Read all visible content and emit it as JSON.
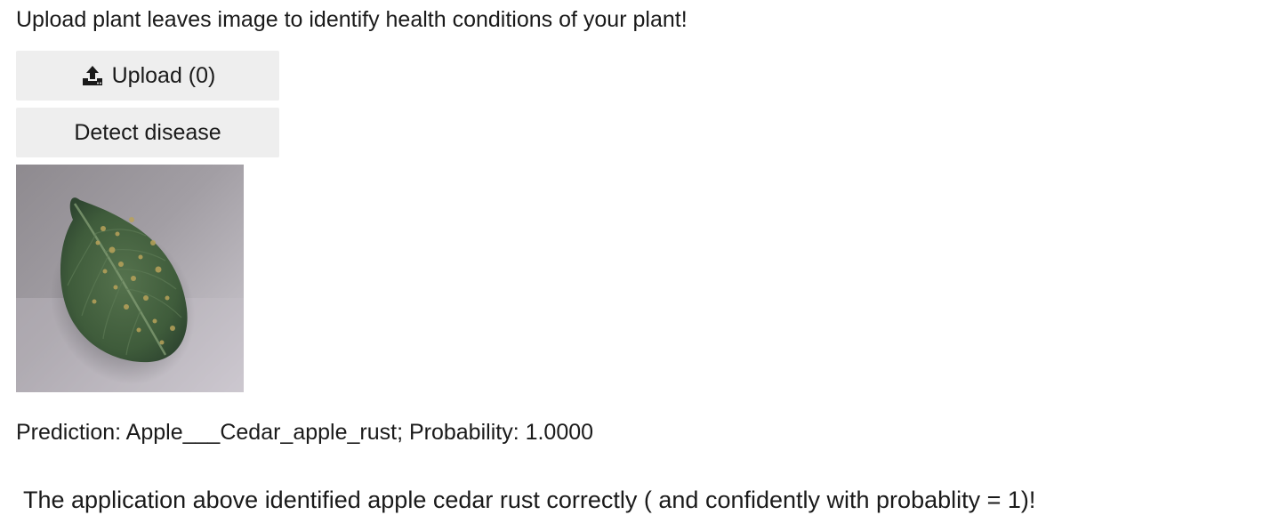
{
  "intro_text": "Upload plant leaves image to identify health conditions of your plant!",
  "upload_button": {
    "icon": "upload-icon",
    "label": "Upload (0)"
  },
  "detect_button": {
    "label": "Detect disease"
  },
  "prediction_text": "Prediction: Apple___Cedar_apple_rust; Probability: 1.0000",
  "note_text": "The application above identified apple cedar rust correctly ( and confidently with probablity = 1)!",
  "colors": {
    "button_bg": "#eeeeee",
    "text": "#1a1a1a"
  }
}
